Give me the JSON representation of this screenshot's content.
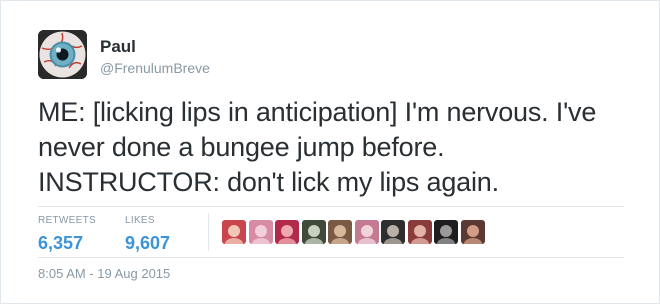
{
  "user": {
    "display_name": "Paul",
    "handle": "@FrenulumBreve",
    "avatar_icon": "eyeball-avatar-icon"
  },
  "tweet": {
    "lines": [
      "ME: [licking lips in anticipation] I'm nervous. I've",
      "never done a bungee jump before.",
      "INSTRUCTOR: don't lick my lips again."
    ]
  },
  "stats": {
    "retweets_label": "RETWEETS",
    "retweets_value": "6,357",
    "likes_label": "LIKES",
    "likes_value": "9,607"
  },
  "likers": [
    {
      "color": "#c9464f",
      "accent": "#f2c7b8"
    },
    {
      "color": "#d98aa6",
      "accent": "#f1d0da"
    },
    {
      "color": "#b22a4a",
      "accent": "#f0a8b0"
    },
    {
      "color": "#3f4a3a",
      "accent": "#c8d0c0"
    },
    {
      "color": "#7a5a45",
      "accent": "#d9b89a"
    },
    {
      "color": "#c47a90",
      "accent": "#f3d3db"
    },
    {
      "color": "#2e2e2e",
      "accent": "#b9b0a8"
    },
    {
      "color": "#8a3b3b",
      "accent": "#e3b3a6"
    },
    {
      "color": "#1e1e1e",
      "accent": "#9a9a9a"
    },
    {
      "color": "#5a3a32",
      "accent": "#d39b86"
    }
  ],
  "timestamp": "8:05 AM - 19 Aug 2015",
  "colors": {
    "text": "#292f33",
    "muted": "#8899a6",
    "stat_value": "#3b94d9",
    "divider": "#e1e8ed"
  }
}
